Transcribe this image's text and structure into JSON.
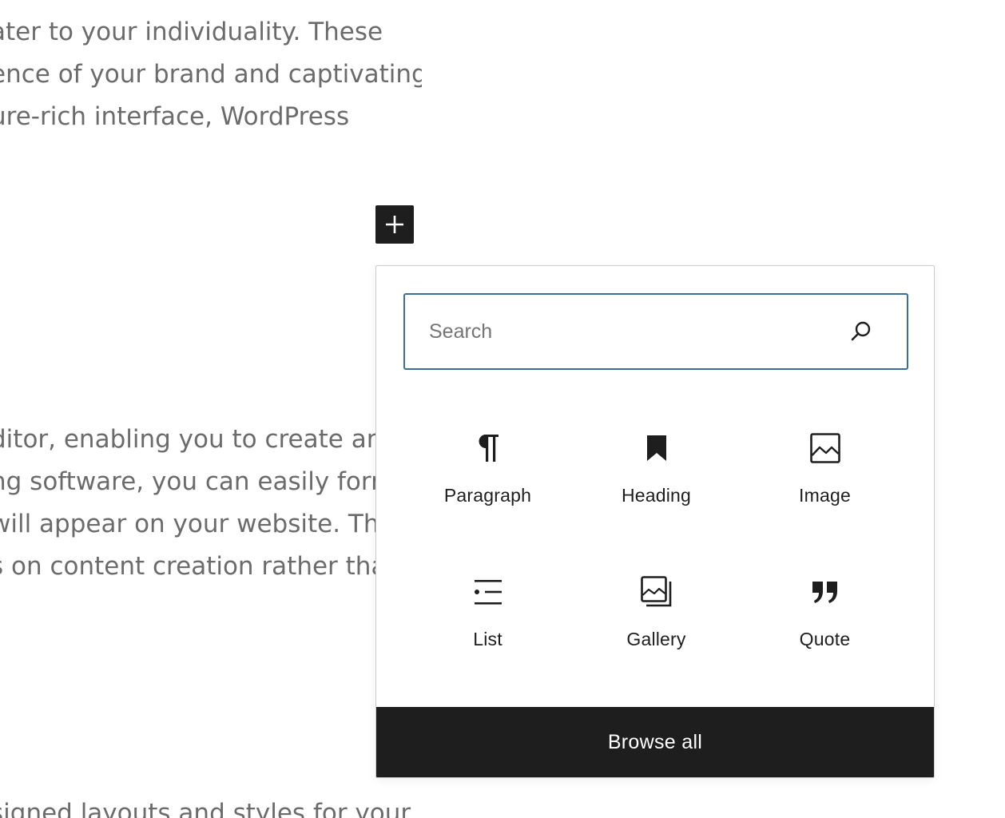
{
  "content": {
    "paragraph_1": [
      "ater to your individuality. These",
      "ence of your brand and captivating",
      "ure-rich interface, WordPress"
    ],
    "paragraph_2": [
      "ditor, enabling you to create and",
      "ng software, you can easily form",
      "will appear on your website. Thi",
      "s on content creation rather tha"
    ],
    "paragraph_3": [
      "signed layouts and styles for your"
    ]
  },
  "inserter": {
    "search": {
      "placeholder": "Search",
      "value": ""
    },
    "blocks": [
      {
        "label": "Paragraph",
        "icon": "paragraph-icon"
      },
      {
        "label": "Heading",
        "icon": "heading-icon"
      },
      {
        "label": "Image",
        "icon": "image-icon"
      },
      {
        "label": "List",
        "icon": "list-icon"
      },
      {
        "label": "Gallery",
        "icon": "gallery-icon"
      },
      {
        "label": "Quote",
        "icon": "quote-icon"
      }
    ],
    "browse_all_label": "Browse all"
  },
  "colors": {
    "dark": "#1e1e1e",
    "search_border": "#3a6f93",
    "body_text": "#6b6b6b"
  }
}
